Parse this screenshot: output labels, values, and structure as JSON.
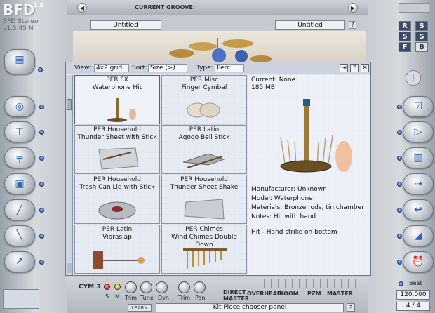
{
  "app": {
    "name": "BFD",
    "version_badge": "1.5",
    "subtitle": "BFD Stereo",
    "version": "v1.5.45 N"
  },
  "header": {
    "current_groove_label": "CURRENT GROOVE:",
    "left_untitled": "Untitled",
    "right_untitled": "Untitled"
  },
  "right_panel": {
    "rss": [
      "R",
      "S",
      "S",
      "F",
      "B"
    ]
  },
  "chooser": {
    "view_label": "View:",
    "view_value": "4x2 grid",
    "sort_label": "Sort:",
    "sort_value": "Size (>)",
    "type_label": "Type:",
    "type_value": "Perc",
    "tiles": [
      {
        "category": "PER FX",
        "name": "Waterphone Hit"
      },
      {
        "category": "PER Misc",
        "name": "Finger Cymbal"
      },
      {
        "category": "PER Household",
        "name": "Thunder Sheet with Stick"
      },
      {
        "category": "PER Latin",
        "name": "Agogo Bell Stick"
      },
      {
        "category": "PER Household",
        "name": "Trash Can Lid with Stick"
      },
      {
        "category": "PER Household",
        "name": "Thunder Sheet Shake"
      },
      {
        "category": "PER Latin",
        "name": "Vibraslap"
      },
      {
        "category": "PER Chimes",
        "name": "Wind Chimes Double Down"
      }
    ],
    "details": {
      "current": "Current: None",
      "size": "185 MB",
      "manufacturer": "Manufacturer: Unknown",
      "model": "Model: Waterphone",
      "materials": "Materials: Bronze rods, tin chamber",
      "notes": "Notes: Hit with hand",
      "hit": "Hit - Hand strike on bottom"
    }
  },
  "mixer": {
    "channel": "CYM 3",
    "s": "S",
    "m": "M",
    "trim": "Trim",
    "tune": "Tune",
    "dyn": "Dyn",
    "trim2": "Trim",
    "pan": "Pan",
    "direct": "DIRECT",
    "master_sub": "MASTER",
    "overhead": "OVERHEAD",
    "room": "ROOM",
    "pzm": "PZM",
    "master": "MASTER"
  },
  "status": {
    "learn": "LEARN",
    "text": "Kit Piece chooser panel"
  },
  "tempo": {
    "beat_label": "Beat",
    "bpm": "120.000",
    "signature": "4 / 4"
  },
  "colors": {
    "accent": "#2b66b0",
    "panel": "#e2e6ee"
  }
}
